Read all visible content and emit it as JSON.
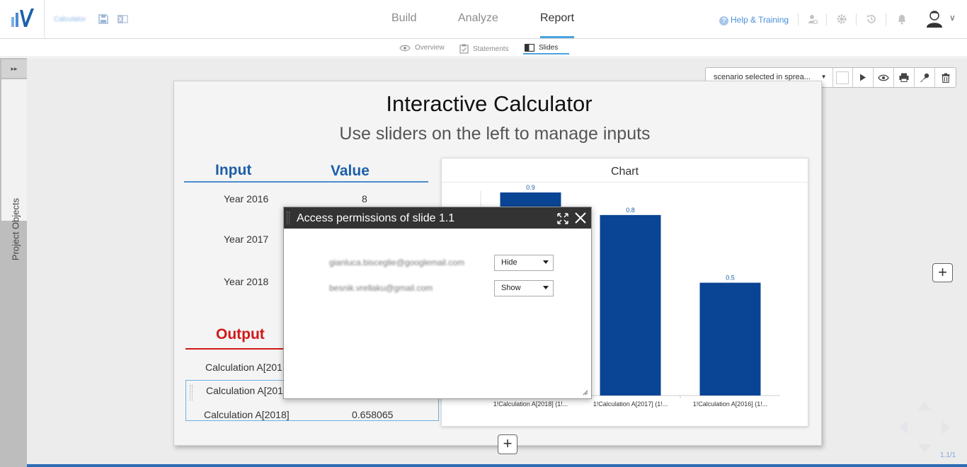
{
  "app": {
    "filename": "Calculator"
  },
  "nav": {
    "tabs": [
      {
        "label": "Build"
      },
      {
        "label": "Analyze"
      },
      {
        "label": "Report"
      }
    ],
    "help_label": "Help & Training"
  },
  "subnav": {
    "tabs": [
      {
        "label": "Overview"
      },
      {
        "label": "Statements"
      },
      {
        "label": "Slides"
      }
    ]
  },
  "sidebar": {
    "label": "Project Objects",
    "toggle_glyph": "▸▸"
  },
  "toolbar": {
    "scenario_value": "scenario selected in sprea..."
  },
  "slide": {
    "title": "Interactive Calculator",
    "subtitle": "Use sliders on the left to manage inputs",
    "input_table": {
      "col_input": "Input",
      "col_value": "Value",
      "rows": [
        {
          "label": "Year 2016",
          "value": "8"
        },
        {
          "label": "Year 2017",
          "value": ""
        },
        {
          "label": "Year 2018",
          "value": ""
        }
      ]
    },
    "output_table": {
      "heading": "Output",
      "rows": [
        {
          "label": "Calculation A[201",
          "value": ""
        },
        {
          "label": "Calculation A[201",
          "value": ""
        },
        {
          "label": "Calculation A[2018]",
          "value": "0.658065"
        }
      ]
    }
  },
  "chart": {
    "title": "Chart"
  },
  "chart_data": {
    "type": "bar",
    "categories": [
      "1!Calculation A[2018] (1!...",
      "1!Calculation A[2017] (1!...",
      "1!Calculation A[2016] (1!..."
    ],
    "values": [
      0.9,
      0.8,
      0.5
    ],
    "data_labels": [
      "0.9",
      "0.8",
      "0.5"
    ],
    "ylim": [
      0,
      0.9
    ],
    "bar_color": "#0a4595"
  },
  "modal": {
    "title": "Access permissions of slide 1.1",
    "permissions": [
      {
        "email": "gianluca.bisceglie@googlemail.com",
        "access": "Hide"
      },
      {
        "email": "besnik.vrellaku@gmail.com",
        "access": "Show"
      }
    ]
  },
  "pager": {
    "label": "1.1/1"
  },
  "colors": {
    "accent": "#4aa3df",
    "input_header": "#1c5fa8",
    "output_header": "#d01818",
    "bar": "#0a4595",
    "modal_header": "#333333"
  }
}
